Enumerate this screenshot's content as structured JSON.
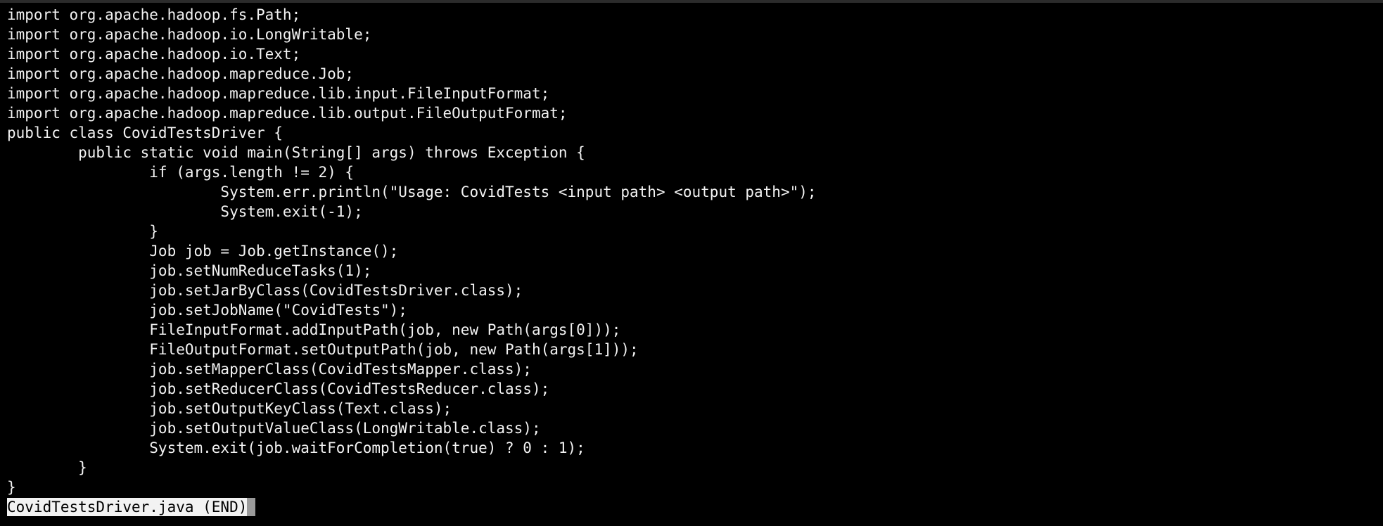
{
  "terminal": {
    "lines": [
      "import org.apache.hadoop.fs.Path;",
      "import org.apache.hadoop.io.LongWritable;",
      "import org.apache.hadoop.io.Text;",
      "import org.apache.hadoop.mapreduce.Job;",
      "import org.apache.hadoop.mapreduce.lib.input.FileInputFormat;",
      "import org.apache.hadoop.mapreduce.lib.output.FileOutputFormat;",
      "public class CovidTestsDriver {",
      "        public static void main(String[] args) throws Exception {",
      "                if (args.length != 2) {",
      "                        System.err.println(\"Usage: CovidTests <input path> <output path>\");",
      "                        System.exit(-1);",
      "                }",
      "                Job job = Job.getInstance();",
      "                job.setNumReduceTasks(1);",
      "                job.setJarByClass(CovidTestsDriver.class);",
      "                job.setJobName(\"CovidTests\");",
      "                FileInputFormat.addInputPath(job, new Path(args[0]));",
      "                FileOutputFormat.setOutputPath(job, new Path(args[1]));",
      "                job.setMapperClass(CovidTestsMapper.class);",
      "                job.setReducerClass(CovidTestsReducer.class);",
      "                job.setOutputKeyClass(Text.class);",
      "                job.setOutputValueClass(LongWritable.class);",
      "                System.exit(job.waitForCompletion(true) ? 0 : 1);",
      "        }",
      "}"
    ],
    "status": "CovidTestsDriver.java (END)",
    "colors": {
      "background": "#000000",
      "foreground": "#f2f2f2",
      "status_background": "#f2f2f2",
      "status_foreground": "#000000",
      "cursor": "#9a9a9a"
    }
  }
}
